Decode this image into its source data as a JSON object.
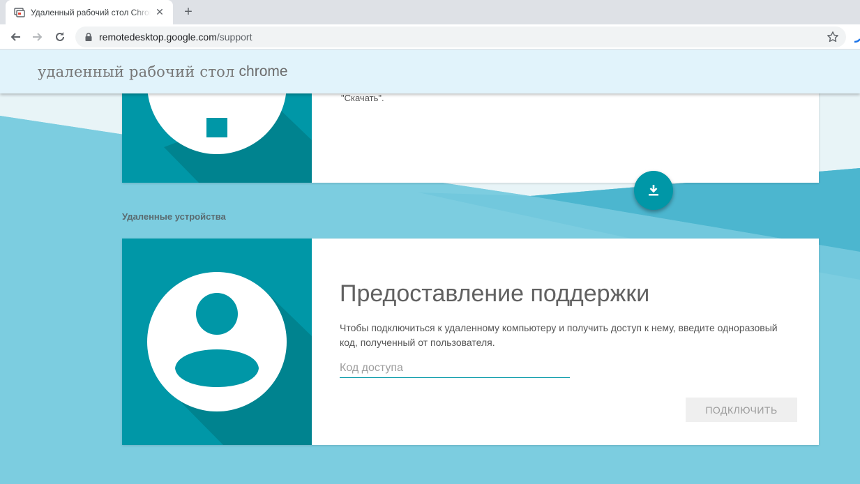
{
  "browser": {
    "tab_title": "Удаленный рабочий стол Chrome",
    "url_host": "remotedesktop.google.com",
    "url_path": "/support"
  },
  "header": {
    "brand_main": "удаленный рабочий стол",
    "brand_chrome": "chrome"
  },
  "download_card": {
    "text": "\"Скачать\"."
  },
  "devices_section": {
    "title": "Удаленные устройства"
  },
  "support_card": {
    "title": "Предоставление поддержки",
    "description": "Чтобы подключиться к удаленному компьютеру и получить доступ к нему, введите одноразовый код, полученный от пользователя.",
    "code_placeholder": "Код доступа",
    "connect_label": "ПОДКЛЮЧИТЬ"
  },
  "colors": {
    "accent": "#0097a7",
    "header_bg": "#e1f3fb",
    "page_bg": "#7fcde0"
  }
}
